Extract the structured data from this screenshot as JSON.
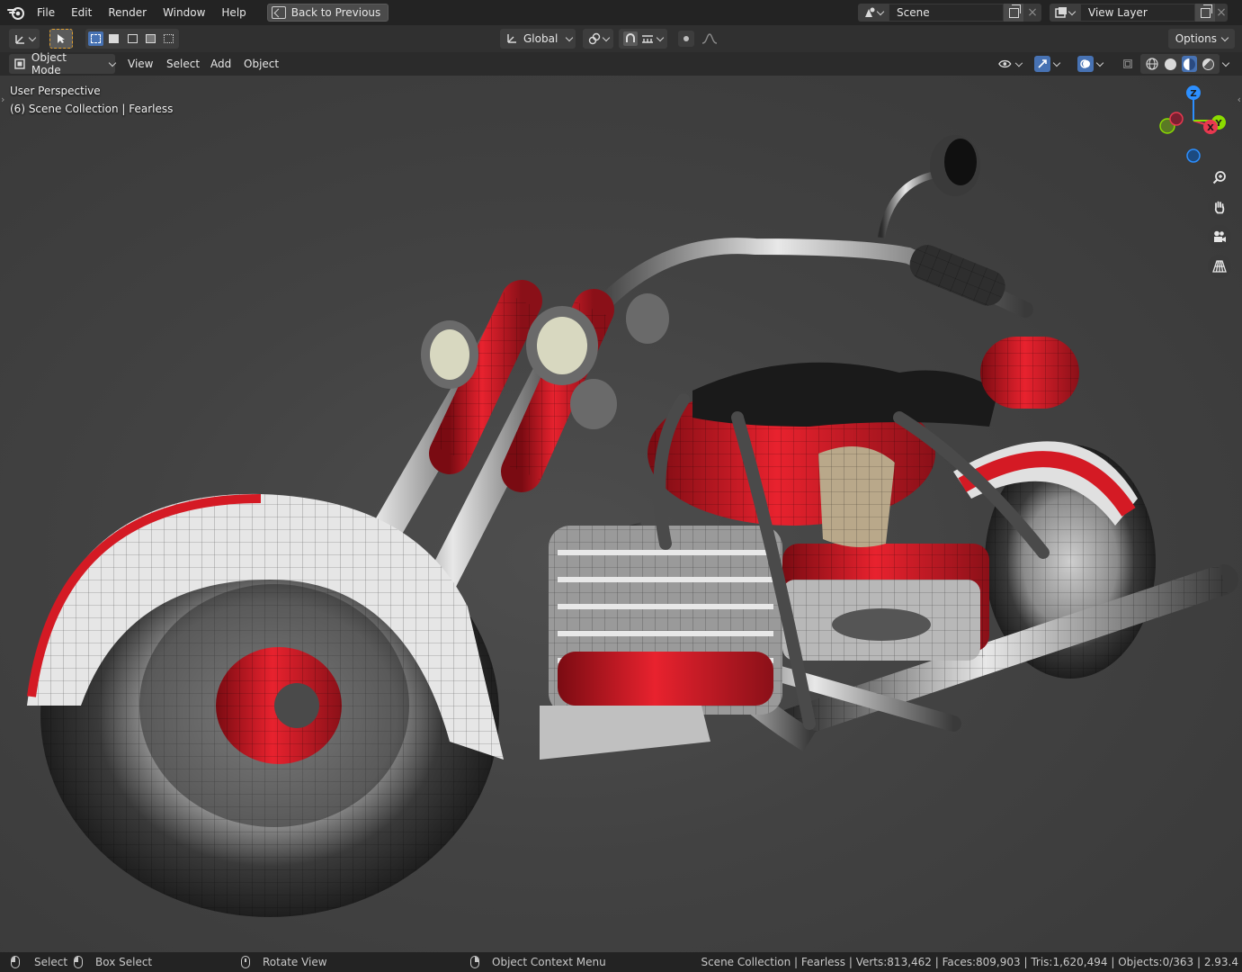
{
  "topbar": {
    "menus": [
      "File",
      "Edit",
      "Render",
      "Window",
      "Help"
    ],
    "back_button": "Back to Previous",
    "scene_name": "Scene",
    "view_layer_name": "View Layer"
  },
  "toolbar": {
    "transform_orientation": "Global",
    "options_label": "Options"
  },
  "header": {
    "mode": "Object Mode",
    "menus": [
      "View",
      "Select",
      "Add",
      "Object"
    ]
  },
  "viewport": {
    "perspective_label": "User Perspective",
    "collection_label": "(6) Scene Collection | Fearless",
    "gizmo_axes": {
      "z": "Z",
      "x": "X",
      "y": "Y"
    }
  },
  "statusbar": {
    "select": "Select",
    "box_select": "Box Select",
    "rotate_view": "Rotate View",
    "context_menu": "Object Context Menu",
    "stats": "Scene Collection | Fearless | Verts:813,462 | Faces:809,903 | Tris:1,620,494 | Objects:0/363 | 2.93.4"
  },
  "colors": {
    "accent_blue": "#4772b3",
    "axis_x": "#e8384f",
    "axis_y": "#8bdc00",
    "axis_z": "#2c8fff",
    "motorcycle_red": "#d41a24",
    "chrome": "#c9c9c9"
  }
}
